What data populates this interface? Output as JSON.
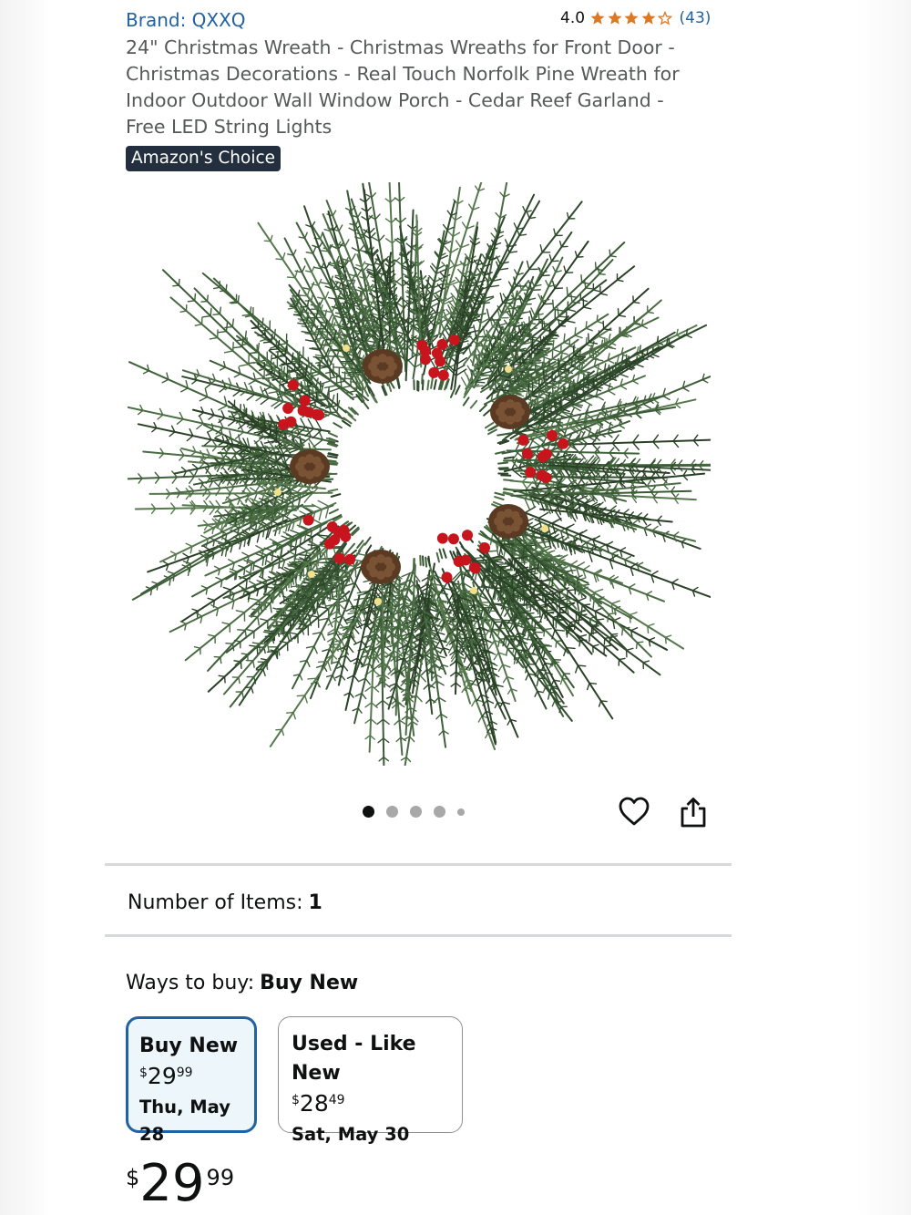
{
  "product": {
    "brand": "Brand: QXXQ",
    "rating_value": "4.0",
    "rating_stars": 4,
    "rating_count": "(43)",
    "title": "24\" Christmas Wreath - Christmas Wreaths for Front Door - Christmas Decorations - Real Touch Norfolk Pine Wreath for Indoor Outdoor Wall Window Porch - Cedar Reef Garland - Free LED String Lights",
    "badge": "Amazon's Choice"
  },
  "gallery": {
    "image_icon": "wreath-product-image",
    "dot_count": 5,
    "active_index": 0
  },
  "actions": {
    "wishlist_icon": "heart-icon",
    "share_icon": "share-icon"
  },
  "variation": {
    "label": "Number of Items:",
    "value": "1"
  },
  "ways_to_buy": {
    "label": "Ways to buy:",
    "selected": "Buy New",
    "options": [
      {
        "title": "Buy New",
        "currency": "$",
        "price_whole": "29",
        "price_fraction": "99",
        "delivery": "Thu, May 28",
        "selected": true
      },
      {
        "title": "Used - Like New",
        "currency": "$",
        "price_whole": "28",
        "price_fraction": "49",
        "delivery": "Sat, May 30",
        "selected": false
      }
    ]
  },
  "price": {
    "currency": "$",
    "whole": "29",
    "fraction": "99"
  },
  "colors": {
    "link": "#2162a1",
    "star": "#de7921",
    "badge_bg": "#232f3e",
    "selected_border": "#2162a1"
  }
}
